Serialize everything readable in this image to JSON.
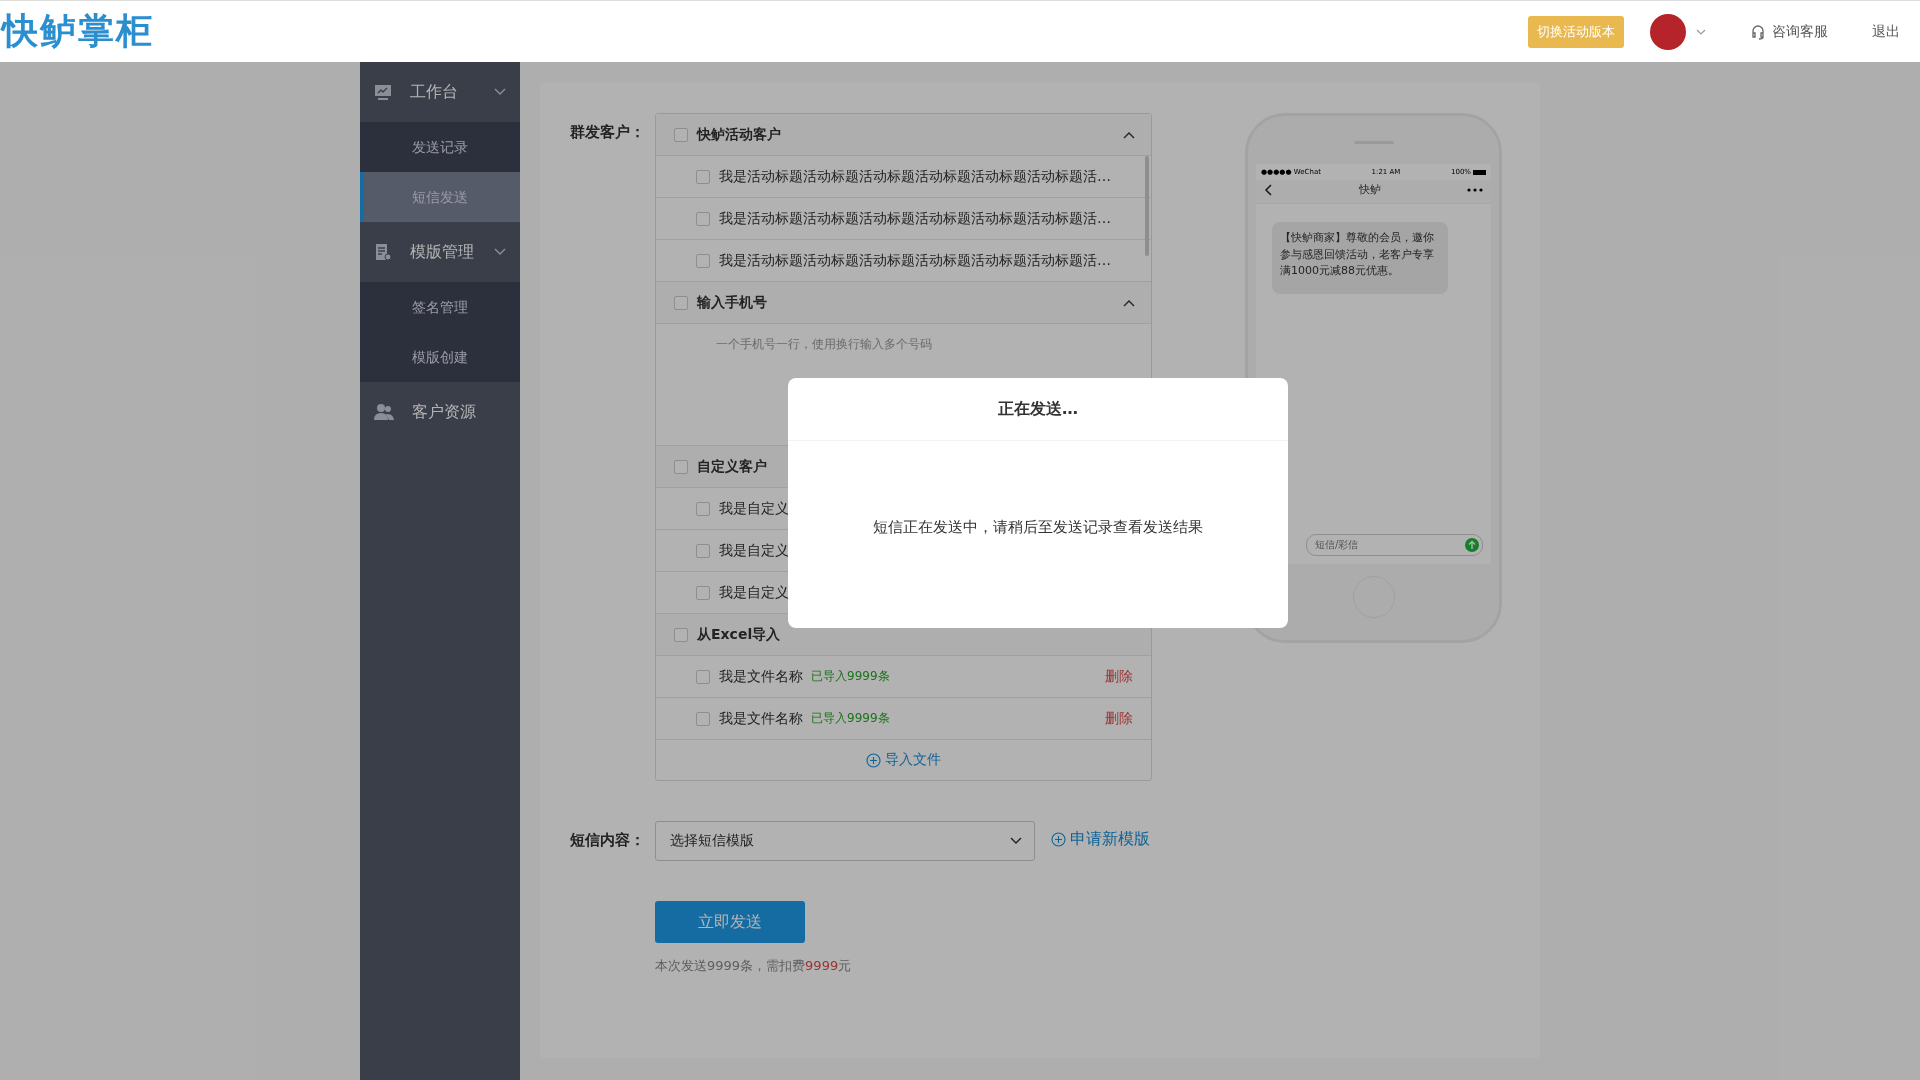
{
  "header": {
    "logo": "快鲈掌柜",
    "switch_button": "切换活动版本",
    "service": "咨询客服",
    "logout": "退出"
  },
  "sidebar": [
    {
      "label": "工作台",
      "expanded": true,
      "children": [
        {
          "label": "发送记录",
          "selected": false
        },
        {
          "label": "短信发送",
          "selected": true
        }
      ]
    },
    {
      "label": "模版管理",
      "expanded": true,
      "children": [
        {
          "label": "签名管理",
          "selected": false
        },
        {
          "label": "模版创建",
          "selected": false
        }
      ]
    },
    {
      "label": "客户资源"
    }
  ],
  "form": {
    "recipients_label": "群发客户：",
    "sections": [
      {
        "kind": "group",
        "title": "快鲈活动客户",
        "checked": false,
        "expanded": true,
        "items": [
          {
            "text": "我是活动标题活动标题活动标题活动标题活动标题活动标题活…",
            "checked": false
          },
          {
            "text": "我是活动标题活动标题活动标题活动标题活动标题活动标题活…",
            "checked": false
          },
          {
            "text": "我是活动标题活动标题活动标题活动标题活动标题活动标题活…",
            "checked": false
          }
        ]
      },
      {
        "kind": "textarea",
        "title": "输入手机号",
        "checked": false,
        "expanded": true,
        "placeholder": "一个手机号一行，使用换行输入多个号码"
      },
      {
        "kind": "group",
        "title": "自定义客户",
        "checked": false,
        "expanded": true,
        "items": [
          {
            "text": "我是自定义",
            "checked": false
          },
          {
            "text": "我是自定义",
            "checked": false
          },
          {
            "text": "我是自定义",
            "checked": false
          }
        ]
      },
      {
        "kind": "files",
        "title": "从Excel导入",
        "checked": false,
        "items": [
          {
            "name": "我是文件名称",
            "status": "已导入9999条",
            "action": "删除",
            "checked": false
          },
          {
            "name": "我是文件名称",
            "status": "已导入9999条",
            "action": "删除",
            "checked": false
          }
        ],
        "add_label": "导入文件"
      }
    ],
    "content_label": "短信内容：",
    "select_placeholder": "选择短信模版",
    "apply_link": "申请新模版",
    "send_button": "立即发送",
    "cost": {
      "before": "本次发送9999条，需扣费",
      "amount": "9999",
      "after": "元"
    }
  },
  "phone": {
    "carrier": "●●●●● WeChat",
    "time": "1:21 AM",
    "battery": "100%",
    "chat_title": "快鲈",
    "message": "【快鲈商家】尊敬的会员，邀你参与感恩回馈活动，老客户专享满1000元减88元优惠。",
    "input_placeholder": "短信/彩信"
  },
  "modal": {
    "title": "正在发送…",
    "message": "短信正在发送中，请稍后至发送记录查看发送结果"
  }
}
